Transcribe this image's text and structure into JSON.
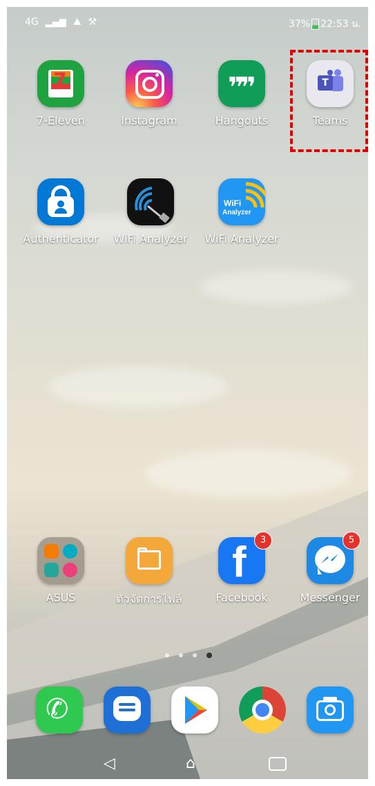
{
  "status_bar": {
    "network": "4G",
    "battery": "37%",
    "time": "22:53 น."
  },
  "home_rows": {
    "row1": [
      {
        "label": "7-Eleven",
        "icon": "7-eleven-icon"
      },
      {
        "label": "Instagram",
        "icon": "instagram-icon"
      },
      {
        "label": "Hangouts",
        "icon": "hangouts-icon"
      },
      {
        "label": "Teams",
        "icon": "teams-icon"
      }
    ],
    "row2": [
      {
        "label": "Authenticator",
        "icon": "authenticator-icon"
      },
      {
        "label": "WiFi Analyzer",
        "icon": "wifi-analyzer-dark-icon"
      },
      {
        "label": "WiFi Analyzer",
        "icon": "wifi-analyzer-blue-icon"
      }
    ],
    "row3": [
      {
        "label": "ASUS",
        "icon": "asus-folder-icon"
      },
      {
        "label": "ตัวจัดการไฟล์",
        "icon": "file-manager-icon"
      },
      {
        "label": "Facebook",
        "icon": "facebook-icon",
        "badge": "3"
      },
      {
        "label": "Messenger",
        "icon": "messenger-icon",
        "badge": "5"
      }
    ]
  },
  "dock": [
    "phone-icon",
    "messages-icon",
    "play-store-icon",
    "chrome-icon",
    "camera-icon"
  ],
  "page_indicator": {
    "count": 4,
    "active": 4
  },
  "colors": {
    "highlight": "#e00000",
    "badge": "#e5322d"
  }
}
